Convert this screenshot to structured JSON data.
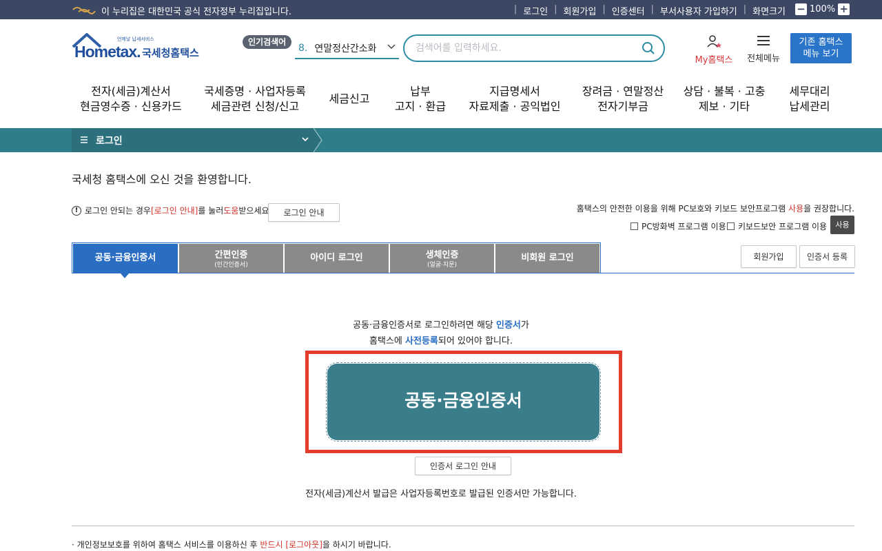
{
  "govbar": {
    "message": "이 누리집은 대한민국 공식 전자정부 누리집입니다.",
    "links": [
      "로그인",
      "회원가입",
      "인증센터",
      "부서사용자 가입하기",
      "화면크기"
    ],
    "zoom": "100%"
  },
  "header": {
    "logo_text": "Hometax.",
    "logo_kr": "국세청홈택스",
    "logo_tiny": "언제낳 납세서비스",
    "popular_badge": "인기검색어",
    "popular_num": "8.",
    "popular_term": "연말정산간소화",
    "search_placeholder": "검색어를 입력하세요.",
    "my_label": "My홈택스",
    "all_menu_label": "전체메뉴",
    "old_menu_line1": "기존 홈택스",
    "old_menu_line2": "메뉴 보기"
  },
  "gnb": [
    {
      "l1": "전자(세금)계산서",
      "l2": "현금영수증 · 신용카드"
    },
    {
      "l1": "국세증명 · 사업자등록",
      "l2": "세금관련 신청/신고"
    },
    {
      "l1": "세금신고",
      "l2": ""
    },
    {
      "l1": "납부",
      "l2": "고지 · 환급"
    },
    {
      "l1": "지급명세서",
      "l2": "자료제출 · 공익법인"
    },
    {
      "l1": "장려금 · 연말정산",
      "l2": "전자기부금"
    },
    {
      "l1": "상담 · 불복 · 고충",
      "l2": "제보 · 기타"
    },
    {
      "l1": "세무대리",
      "l2": "납세관리"
    }
  ],
  "breadcrumb": "로그인",
  "welcome": "국세청 홈택스에 오신 것을 환영합니다.",
  "help": {
    "pre": "로그인 안되는 경우 ",
    "link": "[로그인 안내]",
    "mid": "를 눌러 ",
    "help_word": "도움",
    "post": "받으세요.",
    "button": "로그인 안내"
  },
  "security": {
    "pre": "홈택스의 안전한 이용을 위해 PC보호와 키보드 보안프로그램 ",
    "use_word": "사용",
    "post": "을 권장합니다.",
    "chk1": "PC방화벽 프로그램 이용",
    "chk2": "키보드보안 프로그램 이용",
    "use_button": "사용"
  },
  "tabs": [
    {
      "main": "공동·금융인증서",
      "sub": ""
    },
    {
      "main": "간편인증",
      "sub": "(민간인증서)"
    },
    {
      "main": "아이디 로그인",
      "sub": ""
    },
    {
      "main": "생체인증",
      "sub": "(얼굴·지문)"
    },
    {
      "main": "비회원 로그인",
      "sub": ""
    }
  ],
  "side_buttons": {
    "join": "회원가입",
    "register_cert": "인증서 등록"
  },
  "info": {
    "line1_pre": "공동·금융인증서로 로그인하려면 해당 ",
    "line1_em": "인증서",
    "line1_post": "가",
    "line2_pre": "홈택스에 ",
    "line2_em": "사전등록",
    "line2_post": "되어 있어야 합니다."
  },
  "cert_button": "공동·금융인증서",
  "cert_guide_button": "인증서 로그인 안내",
  "note": "전자(세금)계산서 발급은 사업자등록번호로 발급된 인증서만 가능합니다.",
  "bottom": {
    "pre": "개인정보보호를 위하여 홈택스 서비스를 이용하신 후 ",
    "em": "반드시 [로그아웃]",
    "post": "을 하시기 바랍니다."
  },
  "colors": {
    "teal": "#2e7d8a",
    "blue": "#2a6ec3",
    "highlight": "#e23c2c",
    "cert_button": "#3a7e8c"
  }
}
